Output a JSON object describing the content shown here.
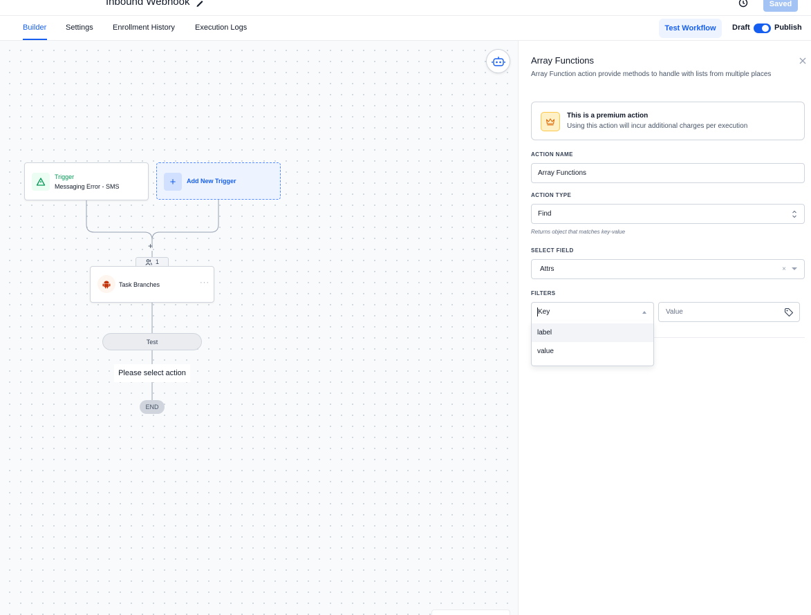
{
  "header": {
    "workflow_title": "Inbound Webhook",
    "saved_label": "Saved"
  },
  "tabs": [
    {
      "label": "Builder",
      "active": true
    },
    {
      "label": "Settings",
      "active": false
    },
    {
      "label": "Enrollment History",
      "active": false
    },
    {
      "label": "Execution Logs",
      "active": false
    }
  ],
  "toolbar": {
    "test_workflow_label": "Test Workflow",
    "draft_label": "Draft",
    "publish_label": "Publish",
    "publish_toggle_on": true
  },
  "canvas": {
    "trigger": {
      "label": "Trigger",
      "name": "Messaging Error - SMS",
      "icon": "warning-triangle-icon"
    },
    "add_trigger": {
      "label": "Add New Trigger",
      "icon": "plus-icon"
    },
    "join_plus": "+",
    "enrolled_count": "1",
    "action_node": {
      "label": "Task Branches",
      "icon": "android-icon",
      "menu": "···"
    },
    "branch": {
      "label": "Test"
    },
    "empty_action": {
      "label": "Please select action"
    },
    "end": {
      "label": "END"
    }
  },
  "panel": {
    "title": "Array Functions",
    "description": "Array Function action provide methods to handle with lists from multiple places",
    "premium": {
      "title": "This is a premium action",
      "subtitle": "Using this action will incur additional charges per execution"
    },
    "action_name": {
      "label": "ACTION NAME",
      "value": "Array Functions"
    },
    "action_type": {
      "label": "ACTION TYPE",
      "value": "Find",
      "hint": "Returns object that matches key-value"
    },
    "select_field": {
      "label": "SELECT FIELD",
      "value": "Attrs",
      "clear": "×"
    },
    "filters": {
      "label": "FILTERS",
      "key_placeholder": "Key",
      "value_placeholder": "Value",
      "options": [
        "label",
        "value"
      ]
    }
  },
  "colors": {
    "accent": "#155eef",
    "trigger_green": "#039855",
    "premium_yellow": "#fec84b",
    "android_orange": "#c4320a"
  }
}
